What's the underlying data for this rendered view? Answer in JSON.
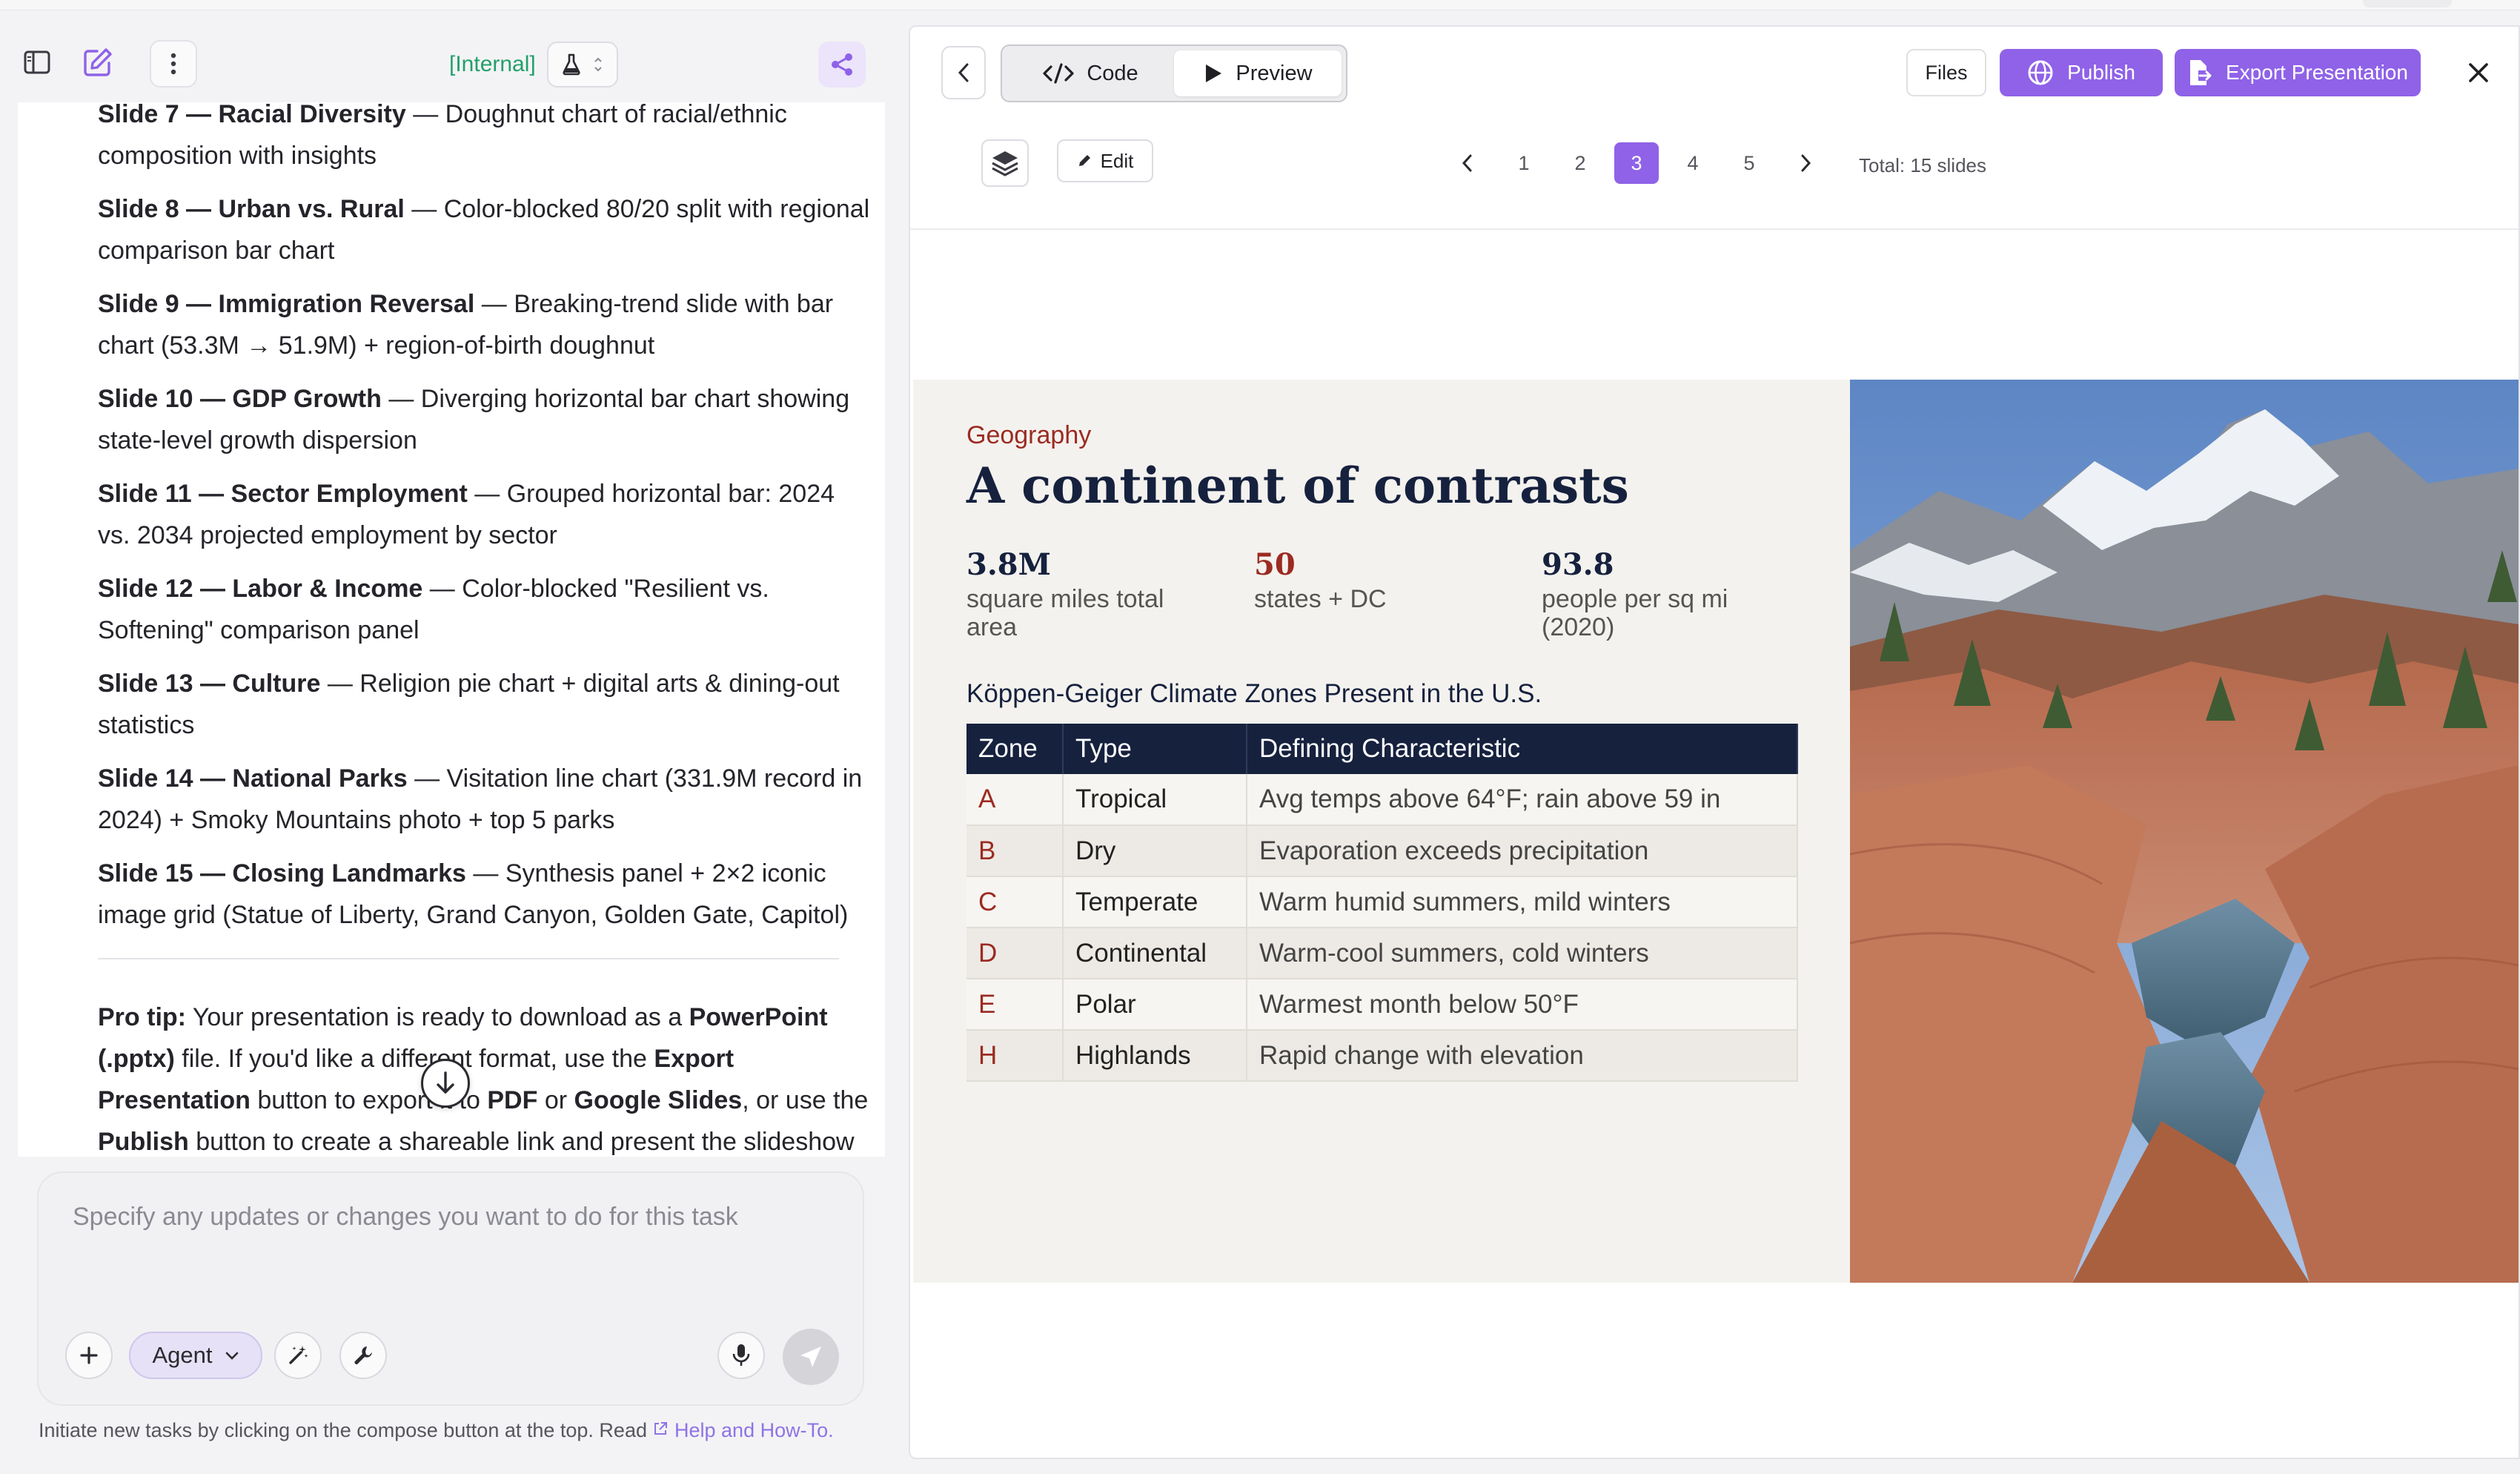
{
  "left_header": {
    "internal_label": "[Internal]"
  },
  "chat": {
    "slides": [
      {
        "label": "Slide 7 — Racial Diversity",
        "desc": " — Doughnut chart of racial/ethnic composition with insights"
      },
      {
        "label": "Slide 8 — Urban vs. Rural",
        "desc": " — Color-blocked 80/20 split with regional comparison bar chart"
      },
      {
        "label": "Slide 9 — Immigration Reversal",
        "desc": " — Breaking-trend slide with bar chart (53.3M → 51.9M) + region-of-birth doughnut"
      },
      {
        "label": "Slide 10 — GDP Growth",
        "desc": " — Diverging horizontal bar chart showing state-level growth dispersion"
      },
      {
        "label": "Slide 11 — Sector Employment",
        "desc": " — Grouped horizontal bar: 2024 vs. 2034 projected employment by sector"
      },
      {
        "label": "Slide 12 — Labor & Income",
        "desc": " — Color-blocked \"Resilient vs. Softening\" comparison panel"
      },
      {
        "label": "Slide 13 — Culture",
        "desc": " — Religion pie chart + digital arts & dining-out statistics"
      },
      {
        "label": "Slide 14 — National Parks",
        "desc": " — Visitation line chart (331.9M record in 2024) + Smoky Mountains photo + top 5 parks"
      },
      {
        "label": "Slide 15 — Closing Landmarks",
        "desc": " — Synthesis panel + 2×2 iconic image grid (Statue of Liberty, Grand Canyon, Golden Gate, Capitol)"
      }
    ],
    "tip": {
      "lead": "Pro tip:",
      "t1": " Your presentation is ready to download as a ",
      "b1": "PowerPoint (.pptx)",
      "t2": " file. If you'd like a different format, use the ",
      "b2": "Export Presentation",
      "t3": " button to export it to ",
      "b3": "PDF",
      "t4": " or ",
      "b4": "Google Slides",
      "t5": ", or use the ",
      "b5": "Publish",
      "t6": " button to create a shareable link and present the slideshow"
    }
  },
  "composer": {
    "placeholder": "Specify any updates or changes you want to do for this task",
    "agent_label": "Agent"
  },
  "footer": {
    "text": "Initiate new tasks by clicking on the compose button at the top. Read ",
    "link": "Help and How-To."
  },
  "right_toolbar": {
    "code_label": "Code",
    "preview_label": "Preview",
    "files_label": "Files",
    "publish_label": "Publish",
    "export_label": "Export Presentation",
    "edit_label": "Edit",
    "pages": [
      "1",
      "2",
      "3",
      "4",
      "5"
    ],
    "current_page": "3",
    "total_label": "Total: 15 slides"
  },
  "slide": {
    "eyebrow": "Geography",
    "title": "A continent of contrasts",
    "stats": [
      {
        "value": "3.8M",
        "label": "square miles total area"
      },
      {
        "value": "50",
        "label": "states + DC"
      },
      {
        "value": "93.8",
        "label": "people per sq mi (2020)"
      }
    ],
    "table_title": "Köppen-Geiger Climate Zones Present in the U.S.",
    "table_headers": [
      "Zone",
      "Type",
      "Defining Characteristic"
    ],
    "table_rows": [
      [
        "A",
        "Tropical",
        "Avg temps above 64°F; rain above 59 in"
      ],
      [
        "B",
        "Dry",
        "Evaporation exceeds precipitation"
      ],
      [
        "C",
        "Temperate",
        "Warm humid summers, mild winters"
      ],
      [
        "D",
        "Continental",
        "Warm-cool summers, cold winters"
      ],
      [
        "E",
        "Polar",
        "Warmest month below 50°F"
      ],
      [
        "H",
        "Highlands",
        "Rapid change with elevation"
      ]
    ]
  },
  "colors": {
    "accent": "#8f62e8",
    "slide_navy": "#16213e",
    "slide_red": "#9b2b22",
    "internal_green": "#22a06b"
  },
  "icons": [
    "sidebar-icon",
    "compose-icon",
    "more-vertical-icon",
    "flask-icon",
    "share-icon",
    "arrow-down-icon",
    "plus-icon",
    "magic-wand-icon",
    "wrench-icon",
    "microphone-icon",
    "send-icon",
    "external-link-icon",
    "chevron-left-icon",
    "code-icon",
    "play-icon",
    "globe-icon",
    "file-export-icon",
    "close-icon",
    "layers-icon",
    "pencil-icon",
    "chevron-right-icon"
  ]
}
